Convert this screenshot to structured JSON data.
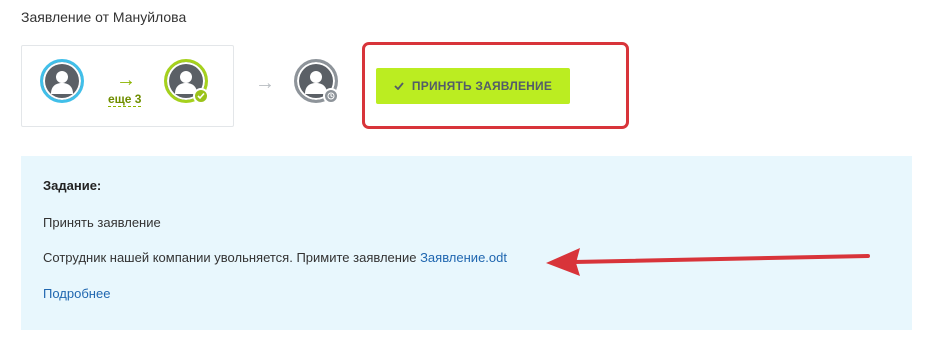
{
  "header": {
    "title": "Заявление от Мануйлова"
  },
  "workflow": {
    "more_link": "еще 3",
    "accept_button_label": "ПРИНЯТЬ ЗАЯВЛЕНИЕ",
    "icons": {
      "arrow_green": "arrow-right-icon",
      "arrow_gray": "arrow-right-icon",
      "check_badge": "check-icon",
      "clock_badge": "clock-icon",
      "avatar": "user-icon"
    }
  },
  "task": {
    "heading": "Задание:",
    "name": "Принять заявление",
    "description": "Сотрудник нашей компании увольняется. Примите заявление",
    "attachment_link": "Заявление.odt",
    "details_link": "Подробнее"
  },
  "colors": {
    "accent_green": "#bbed21",
    "highlight_red": "#d8343a",
    "panel_blue": "#e8f7fd",
    "link_blue": "#2067b0"
  }
}
